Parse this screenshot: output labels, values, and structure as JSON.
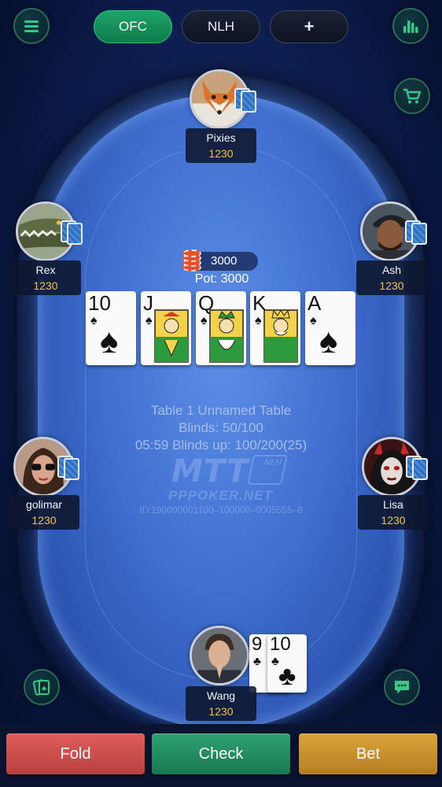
{
  "tabs": [
    {
      "label": "OFC",
      "active": true
    },
    {
      "label": "NLH",
      "active": false
    },
    {
      "label": "+",
      "active": false
    }
  ],
  "icons": {
    "menu": "menu-icon",
    "stats": "bar-chart-icon",
    "shop": "cart-icon",
    "cards": "cards-icon",
    "chat": "chat-icon"
  },
  "players": {
    "top": {
      "name": "Pixies",
      "stack": "1230",
      "avatar": "fox"
    },
    "left_upper": {
      "name": "Rex",
      "stack": "1230",
      "avatar": "crocodile"
    },
    "right_upper": {
      "name": "Ash",
      "stack": "1230",
      "avatar": "man-cap"
    },
    "left_lower": {
      "name": "golimar",
      "stack": "1230",
      "avatar": "woman-sunglasses"
    },
    "right_lower": {
      "name": "Lisa",
      "stack": "1230",
      "avatar": "devil-woman"
    },
    "hero": {
      "name": "Wang",
      "stack": "1230",
      "avatar": "man-praying"
    }
  },
  "pot": {
    "chips_amount": "3000",
    "pot_label": "Pot: 3000"
  },
  "board": [
    {
      "rank": "10",
      "suit": "♠"
    },
    {
      "rank": "J",
      "suit": "♠"
    },
    {
      "rank": "Q",
      "suit": "♠"
    },
    {
      "rank": "K",
      "suit": "♠"
    },
    {
      "rank": "A",
      "suit": "♠"
    }
  ],
  "hero_cards": [
    {
      "rank": "9",
      "suit": "♣"
    },
    {
      "rank": "10",
      "suit": "♣"
    }
  ],
  "table_info": {
    "line1": "Table 1    Unnamed Table",
    "line2": "Blinds: 50/100",
    "line3": "05:59  Blinds up: 100/200(25)",
    "logo": "MTT",
    "logo_badge": "NLH",
    "site": "PPPOKER.NET",
    "id": "ID:190000001100–100000–0005555–8"
  },
  "actions": {
    "fold": "Fold",
    "check": "Check",
    "bet": "Bet"
  },
  "colors": {
    "fold": "#c94a48",
    "check": "#1f8a5c",
    "bet": "#c98f2c",
    "stack": "#f3c14a",
    "felt": "#3f6fd0",
    "active_tab": "#1a9160"
  }
}
